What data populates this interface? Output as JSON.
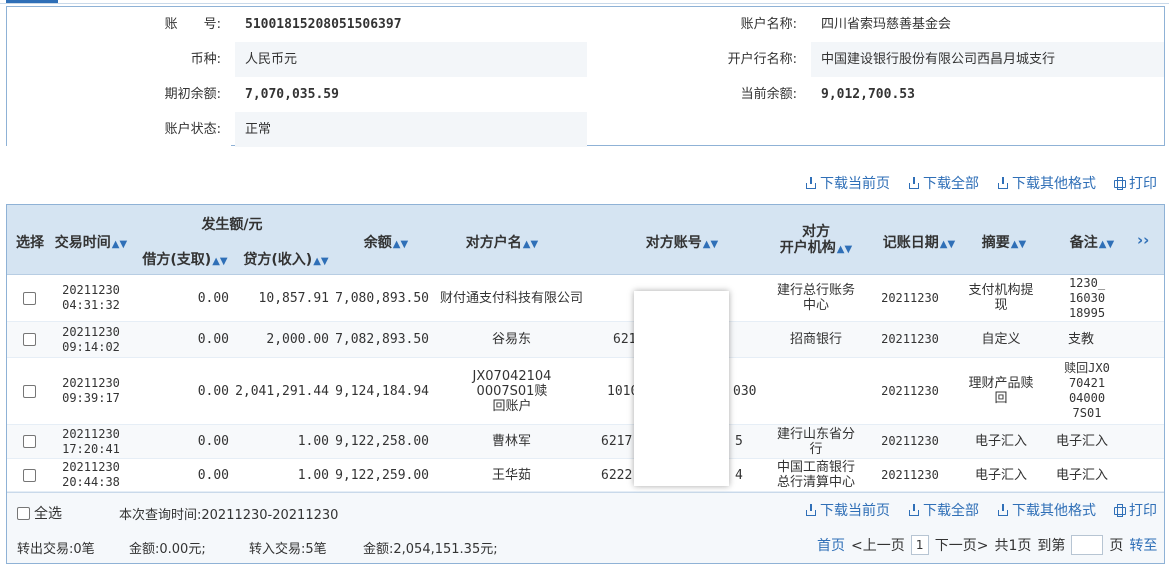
{
  "account": {
    "account_no_label": "账　　号:",
    "account_no": "51001815208051506397",
    "account_name_label": "账户名称:",
    "account_name": "四川省索玛慈善基金会",
    "currency_label": "币种:",
    "currency": "人民币元",
    "bank_label": "开户行名称:",
    "bank": "中国建设银行股份有限公司西昌月城支行",
    "opening_balance_label": "期初余额:",
    "opening_balance": "7,070,035.59",
    "current_balance_label": "当前余额:",
    "current_balance": "9,012,700.53",
    "status_label": "账户状态:",
    "status": "正常"
  },
  "toolbar": {
    "download_page": "下载当前页",
    "download_all": "下载全部",
    "download_other": "下载其他格式",
    "print": "打印"
  },
  "table": {
    "headers": {
      "select": "选择",
      "time": "交易时间",
      "amount_group": "发生额/元",
      "debit": "借方(支取)",
      "credit": "贷方(收入)",
      "balance": "余额",
      "counterparty_name": "对方户名",
      "counterparty_account": "对方账号",
      "counterparty_bank_l1": "对方",
      "counterparty_bank_l2": "开户机构",
      "post_date": "记账日期",
      "summary": "摘要",
      "remark": "备注",
      "more": "››"
    },
    "rows": [
      {
        "date": "20211230",
        "time": "04:31:32",
        "debit": "0.00",
        "credit": "10,857.91",
        "balance": "7,080,893.50",
        "name": "财付通支付科技有限公司",
        "account": "",
        "bank": "建行总行账务中心",
        "post_date": "20211230",
        "summary": "支付机构提现",
        "remark": "1230_ 16030 18995"
      },
      {
        "date": "20211230",
        "time": "09:14:02",
        "debit": "0.00",
        "credit": "2,000.00",
        "balance": "7,082,893.50",
        "name": "谷易东",
        "account": "621",
        "bank": "招商银行",
        "post_date": "20211230",
        "summary": "自定义",
        "remark": "支教"
      },
      {
        "date": "20211230",
        "time": "09:39:17",
        "debit": "0.00",
        "credit": "2,041,291.44",
        "balance": "9,124,184.94",
        "name": "JX07042104 0007S01赎回账户",
        "account": "1010",
        "account_tail": "030",
        "bank": "",
        "post_date": "20211230",
        "summary": "理财产品赎回",
        "remark": "赎回JX0 70421 04000 7S01"
      },
      {
        "date": "20211230",
        "time": "17:20:41",
        "debit": "0.00",
        "credit": "1.00",
        "balance": "9,122,258.00",
        "name": "曹林军",
        "account": "6217",
        "account_tail": "5",
        "bank": "建行山东省分行",
        "post_date": "20211230",
        "summary": "电子汇入",
        "remark": "电子汇入"
      },
      {
        "date": "20211230",
        "time": "20:44:38",
        "debit": "0.00",
        "credit": "1.00",
        "balance": "9,122,259.00",
        "name": "王华茹",
        "account": "6222",
        "account_tail": "4",
        "bank": "中国工商银行总行清算中心",
        "post_date": "20211230",
        "summary": "电子汇入",
        "remark": "电子汇入"
      }
    ]
  },
  "footer": {
    "select_all": "全选",
    "query_time": "本次查询时间:20211230-20211230",
    "out_tx": "转出交易:0笔",
    "out_amount": "金额:0.00元;",
    "in_tx": "转入交易:5笔",
    "in_amount": "金额:2,054,151.35元;",
    "first": "首页",
    "prev": "<上一页",
    "page": "1",
    "next": "下一页>",
    "total": "共1页",
    "goto": "到第",
    "page_unit": "页",
    "go": "转至"
  }
}
